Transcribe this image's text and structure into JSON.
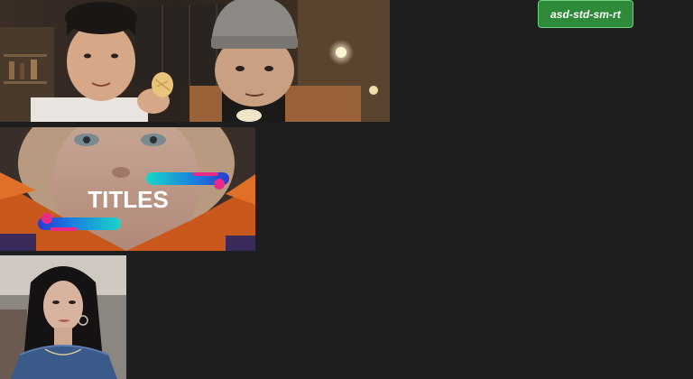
{
  "badge": {
    "label": "asd-std-sm-rt"
  },
  "thumbnails": [
    {
      "name": "two-men-eating-chips-video"
    },
    {
      "name": "titles-template-video",
      "overlay_text": "TITLES"
    },
    {
      "name": "woman-portrait-video"
    }
  ],
  "colors": {
    "background": "#1e1e1e",
    "badge_fill": "#2e8b3a",
    "badge_border": "#6fd37c"
  }
}
